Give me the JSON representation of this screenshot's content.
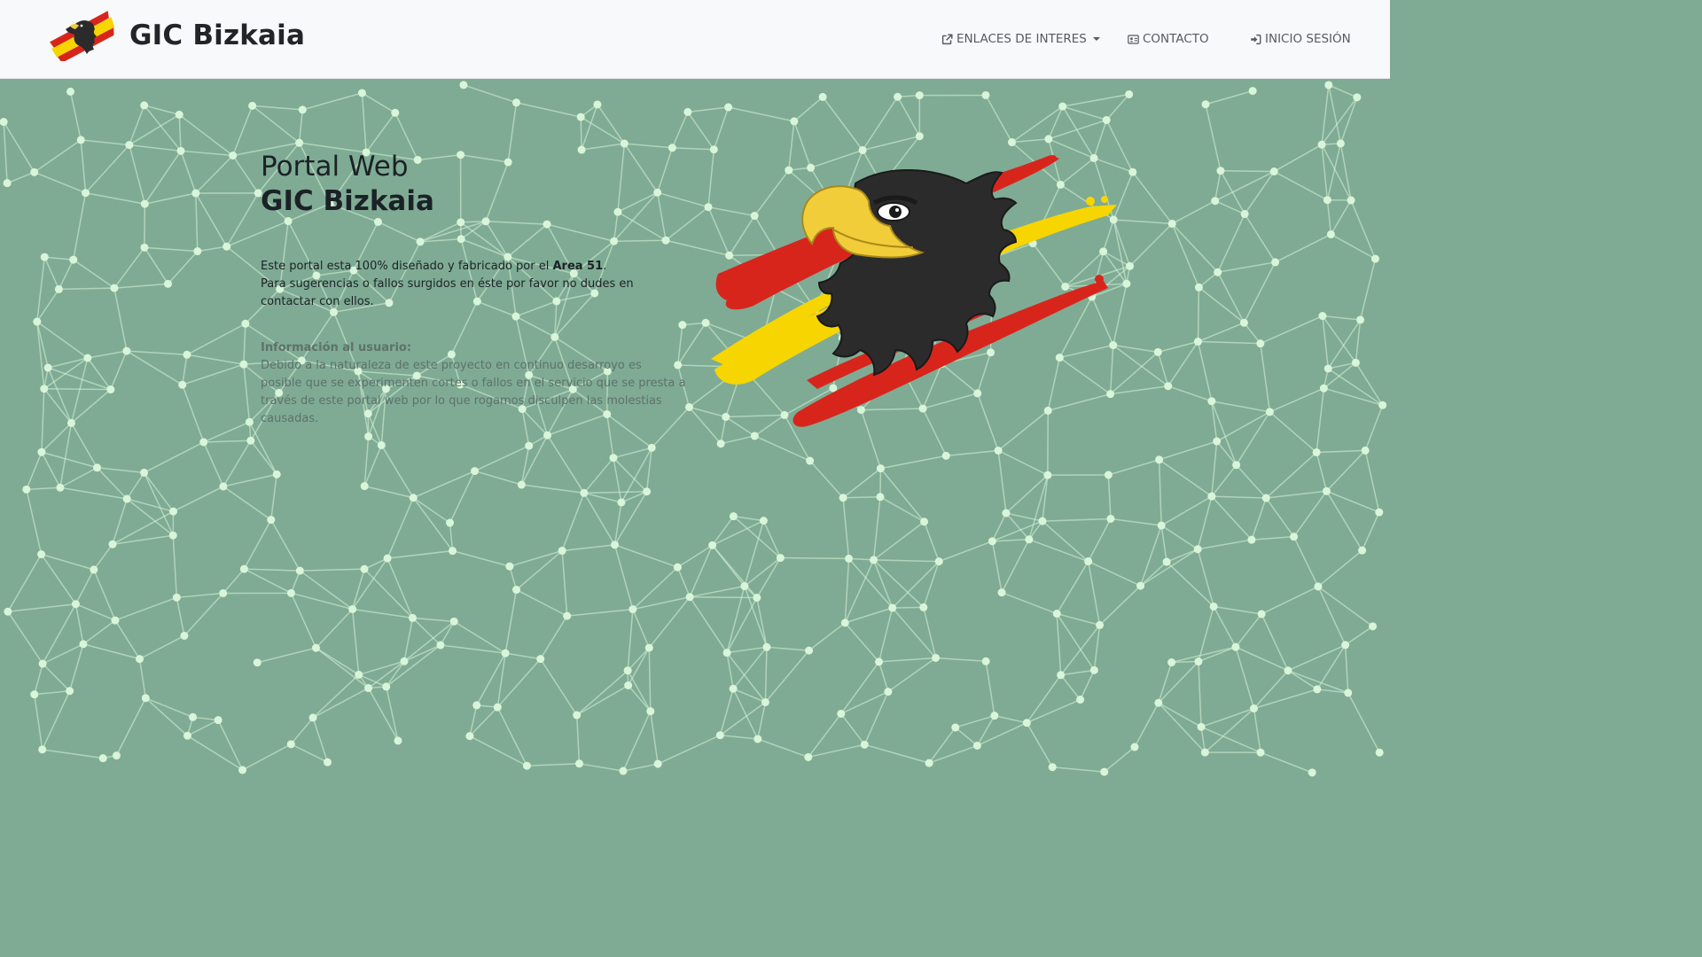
{
  "navbar": {
    "brand_title": "GIC Bizkaia",
    "items": [
      {
        "label": "ENLACES DE INTERES",
        "icon": "external-link-icon",
        "has_dropdown": true
      },
      {
        "label": "CONTACTO",
        "icon": "contact-card-icon",
        "has_dropdown": false
      },
      {
        "label": "INICIO SESIÓN",
        "icon": "sign-in-icon",
        "has_dropdown": false
      }
    ]
  },
  "hero": {
    "title_line1": "Portal Web",
    "title_line2": "GIC Bizkaia",
    "intro_prefix": "Este portal esta 100% diseñado y fabricado por el ",
    "intro_bold": "Area 51",
    "intro_suffix": ".",
    "intro_line2": "Para sugerencias o fallos surgidos en éste por favor no dudes en contactar con ellos.",
    "notice_title": "Información al usuario:",
    "notice_body": "Debido a la naturaleza de este proyecto en continuo desarroyo es posible que se experimenten cortes o fallos en el servicio que se presta a través de este portal web por lo que rogamos disculpen las molestias causadas."
  },
  "colors": {
    "navbar_bg": "#f8f9fa",
    "hero_bg": "#7fab95",
    "network_node": "#d9f5d9",
    "flag_red": "#d8251c",
    "flag_yellow": "#f7d500",
    "eagle_black": "#2b2b2b",
    "beak_yellow": "#f2cd3a"
  }
}
